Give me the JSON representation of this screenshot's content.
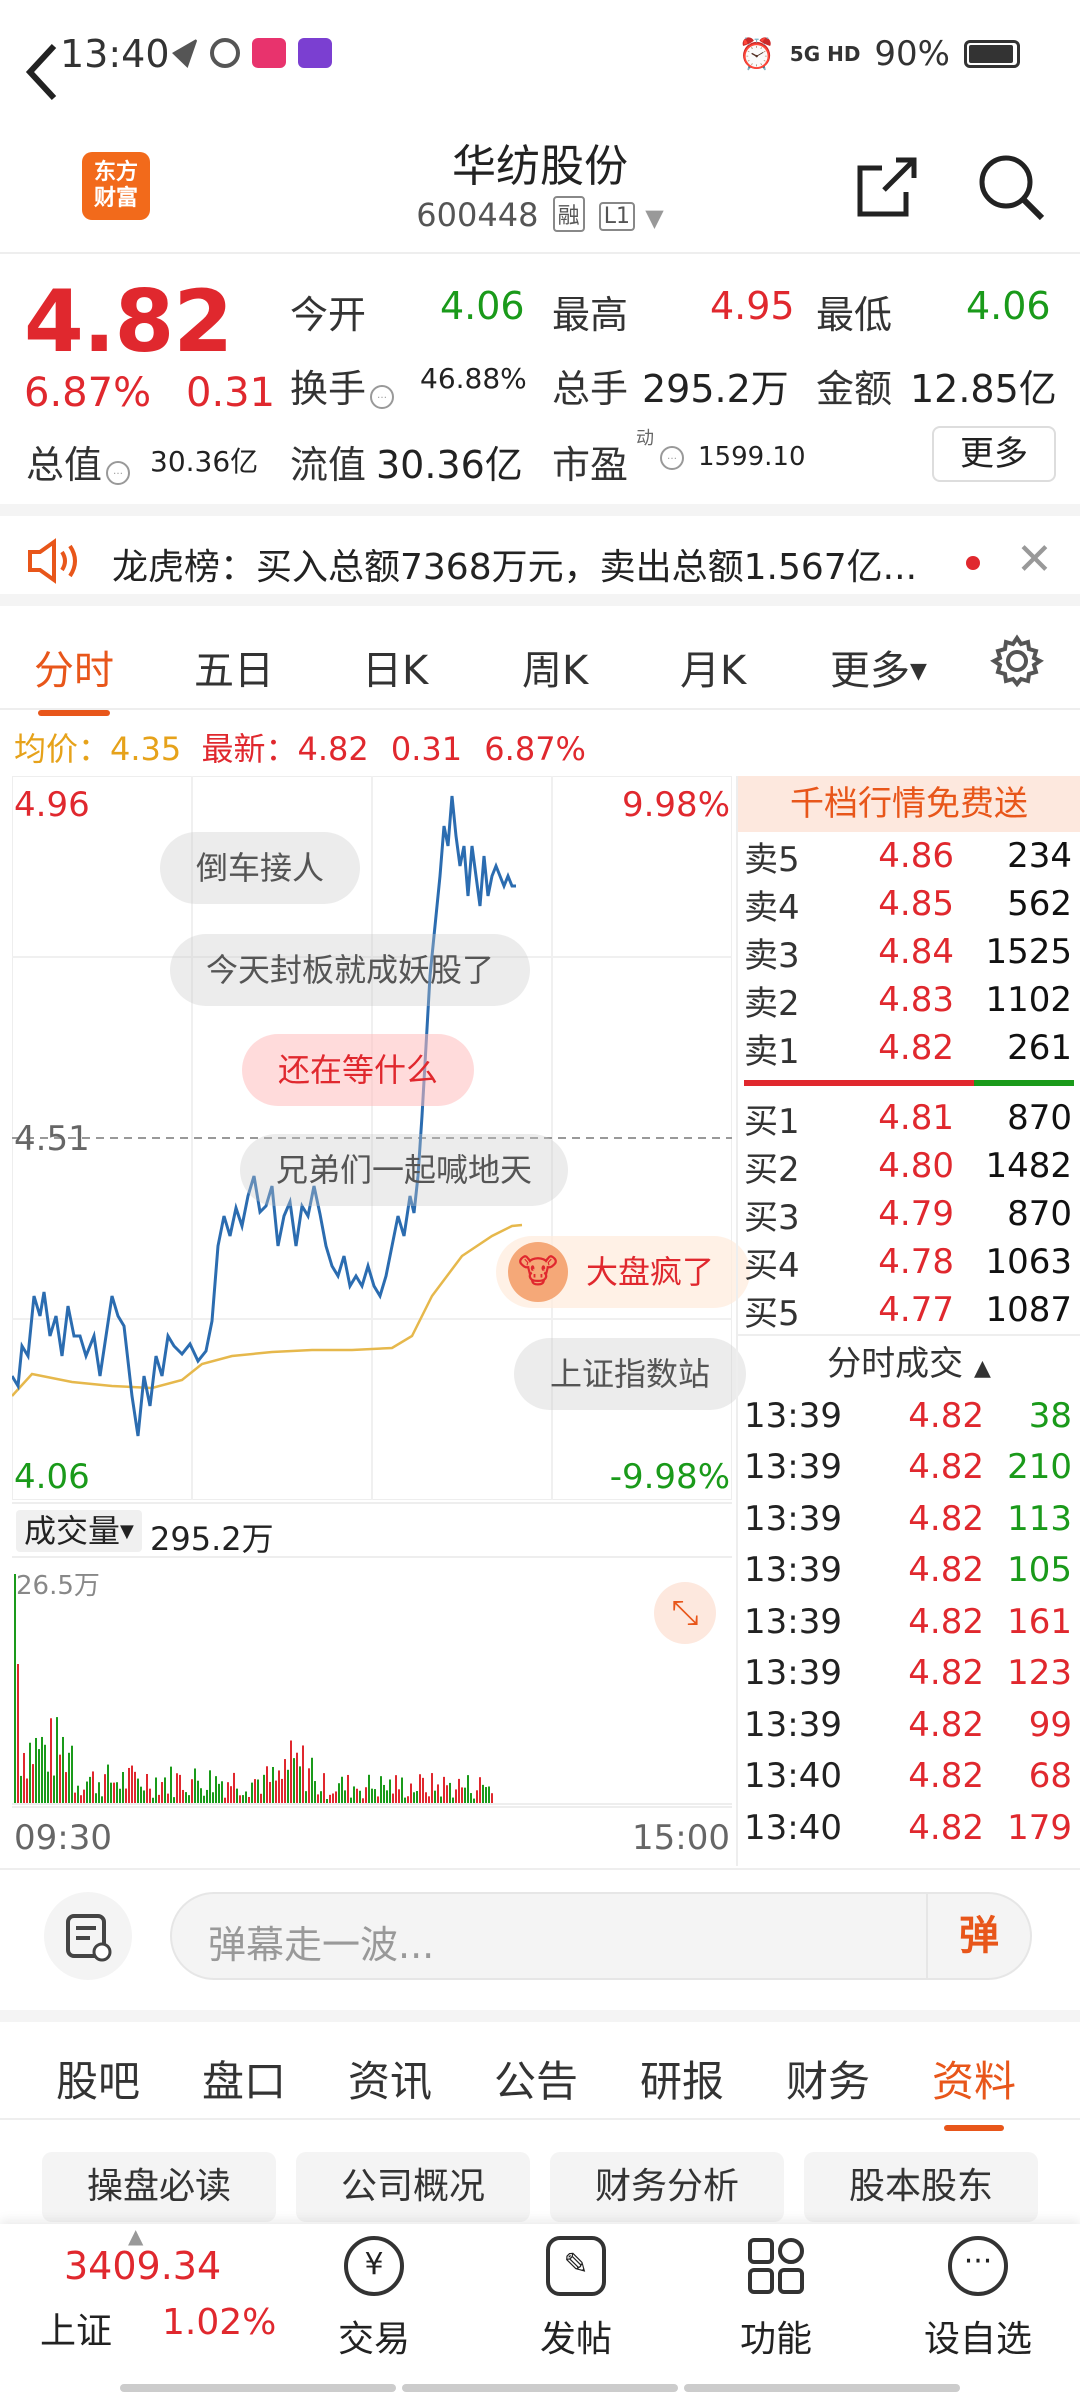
{
  "status_bar": {
    "time": "13:40",
    "network": "5G HD",
    "battery": "90%"
  },
  "header": {
    "title": "华纺股份",
    "code": "600448",
    "tag_rong": "融",
    "tag_l1": "L1",
    "logo_line1": "东方",
    "logo_line2": "财富"
  },
  "quote": {
    "price": "4.82",
    "change_pct": "6.87%",
    "change": "0.31",
    "open_label": "今开",
    "open": "4.06",
    "high_label": "最高",
    "high": "4.95",
    "low_label": "最低",
    "low": "4.06",
    "turnover_label": "换手",
    "turnover": "46.88%",
    "vol_label": "总手",
    "vol": "295.2万",
    "amount_label": "金额",
    "amount": "12.85亿",
    "mktcap_label": "总值",
    "mktcap": "30.36亿",
    "float_label": "流值",
    "float": "30.36亿",
    "pe_label": "市盈",
    "pe_sup": "动",
    "pe": "1599.10",
    "more_label": "更多"
  },
  "notice": {
    "text": "龙虎榜：买入总额7368万元，卖出总额1.567亿..."
  },
  "chart_tabs": [
    "分时",
    "五日",
    "日K",
    "周K",
    "月K",
    "更多"
  ],
  "avg_line": {
    "avg_label": "均价：",
    "avg": "4.35",
    "last_label": "最新：",
    "last": "4.82",
    "chg": "0.31",
    "pct": "6.87%"
  },
  "chart_labels": {
    "top_price": "4.96",
    "top_pct": "9.98%",
    "mid_price": "4.51",
    "bottom_price": "4.06",
    "bottom_pct": "-9.98%",
    "vol_label": "成交量",
    "vol_total": "295.2万",
    "vol_max": "26.5万",
    "start_time": "09:30",
    "end_time": "15:00"
  },
  "danmaku": [
    "倒车接人",
    "今天封板就成妖股了",
    "还在等什么",
    "兄弟们一起喊地天",
    "大盘疯了",
    "上证指数站"
  ],
  "order_book": {
    "banner": "千档行情免费送",
    "asks": [
      {
        "name": "卖5",
        "price": "4.86",
        "qty": "234"
      },
      {
        "name": "卖4",
        "price": "4.85",
        "qty": "562"
      },
      {
        "name": "卖3",
        "price": "4.84",
        "qty": "1525"
      },
      {
        "name": "卖2",
        "price": "4.83",
        "qty": "1102"
      },
      {
        "name": "卖1",
        "price": "4.82",
        "qty": "261"
      }
    ],
    "bids": [
      {
        "name": "买1",
        "price": "4.81",
        "qty": "870"
      },
      {
        "name": "买2",
        "price": "4.80",
        "qty": "1482"
      },
      {
        "name": "买3",
        "price": "4.79",
        "qty": "870"
      },
      {
        "name": "买4",
        "price": "4.78",
        "qty": "1063"
      },
      {
        "name": "买5",
        "price": "4.77",
        "qty": "1087"
      }
    ],
    "trades_header": "分时成交",
    "trades": [
      {
        "time": "13:39",
        "price": "4.82",
        "qty": "38",
        "dir": "buy"
      },
      {
        "time": "13:39",
        "price": "4.82",
        "qty": "210",
        "dir": "buy"
      },
      {
        "time": "13:39",
        "price": "4.82",
        "qty": "113",
        "dir": "buy"
      },
      {
        "time": "13:39",
        "price": "4.82",
        "qty": "105",
        "dir": "buy"
      },
      {
        "time": "13:39",
        "price": "4.82",
        "qty": "161",
        "dir": "sell"
      },
      {
        "time": "13:39",
        "price": "4.82",
        "qty": "123",
        "dir": "sell"
      },
      {
        "time": "13:39",
        "price": "4.82",
        "qty": "99",
        "dir": "sell"
      },
      {
        "time": "13:40",
        "price": "4.82",
        "qty": "68",
        "dir": "sell"
      },
      {
        "time": "13:40",
        "price": "4.82",
        "qty": "179",
        "dir": "sell"
      }
    ]
  },
  "comment": {
    "placeholder": "弹幕走一波...",
    "dan": "弹"
  },
  "info_tabs": [
    "股吧",
    "盘口",
    "资讯",
    "公告",
    "研报",
    "财务",
    "资料"
  ],
  "sub_tabs": [
    "操盘必读",
    "公司概况",
    "财务分析",
    "股本股东"
  ],
  "bottom_nav": {
    "index_value": "3409.34",
    "index_name": "上证",
    "index_pct": "1.02%",
    "items": [
      "交易",
      "发帖",
      "功能",
      "设自选"
    ]
  },
  "colors": {
    "up": "#e0282e",
    "down": "#1a9a1a",
    "accent": "#e8561a",
    "price_line": "#2b6cb0",
    "avg_line": "#e6b84c"
  }
}
